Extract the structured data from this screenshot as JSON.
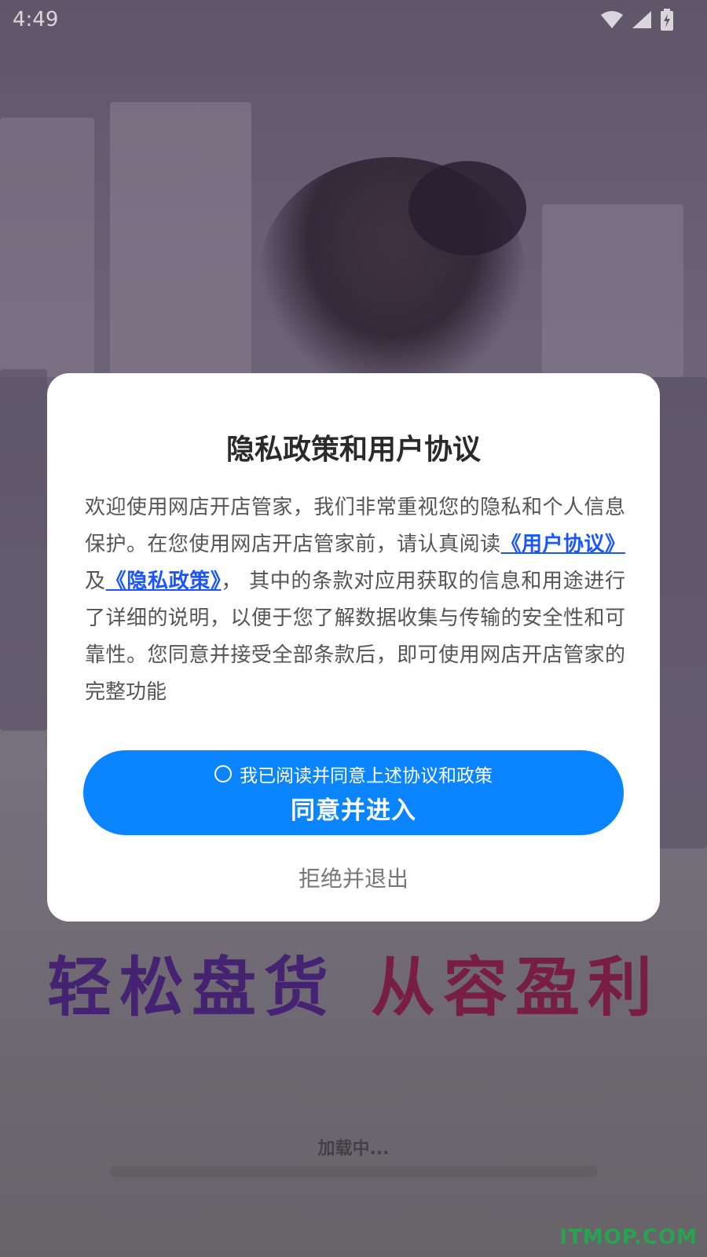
{
  "status_bar": {
    "time": "4:49",
    "icons": [
      "wifi-icon",
      "cellular-signal-icon",
      "battery-charging-icon"
    ]
  },
  "dialog": {
    "title": "隐私政策和用户协议",
    "body_text_1": "欢迎使用网店开店管家，我们非常重视您的隐私和个人信息保护。在您使用网店开店管家前，请认真阅读",
    "link_user_agreement": "《用户协议》",
    "body_text_and": "及",
    "link_privacy_policy": "《隐私政策》",
    "body_text_2": "， 其中的条款对应用获取的信息和用途进行了详细的说明，以便于您了解数据收集与传输的安全性和可靠性。您同意并接受全部条款后，即可使用网店开店管家的完整功能",
    "checkbox_label": "我已阅读并同意上述协议和政策",
    "checkbox_checked": false,
    "agree_button": "同意并进入",
    "reject_button": "拒绝并退出"
  },
  "background": {
    "slogan_part1": "轻松盘货",
    "slogan_part2": "从容盈利",
    "loading_text": "加载中...",
    "watermark": "ITMOP.COM"
  },
  "colors": {
    "primary_button": "#0a84ff",
    "link": "#1a56ff",
    "slogan_part1": "#4d2580",
    "slogan_part2": "#8a1f4a",
    "watermark": "#2dbf5a"
  }
}
